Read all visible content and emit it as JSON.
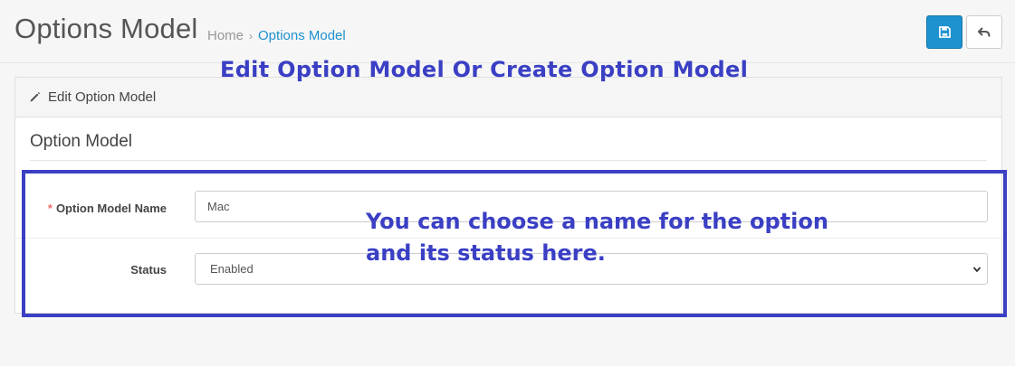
{
  "header": {
    "title": "Options Model",
    "breadcrumb": [
      {
        "label": "Home",
        "active": false
      },
      {
        "label": "Options Model",
        "active": true
      }
    ],
    "breadcrumb_separator": "›",
    "save_icon": "floppy-disk-icon",
    "back_icon": "reply-arrow-icon"
  },
  "annotations": {
    "title": "Edit Option Model Or Create Option Model",
    "body": "You can choose a name for the option and its status here."
  },
  "panel": {
    "heading": "Edit Option Model",
    "heading_icon": "pencil-icon",
    "legend": "Option Model"
  },
  "form": {
    "name_field": {
      "required_mark": "*",
      "label": "Option Model Name",
      "value": "Mac"
    },
    "status_field": {
      "label": "Status",
      "selected": "Enabled"
    }
  },
  "colors": {
    "primary": "#1e91cf",
    "annotation": "#3a3fc4",
    "required": "#f56b6b"
  }
}
